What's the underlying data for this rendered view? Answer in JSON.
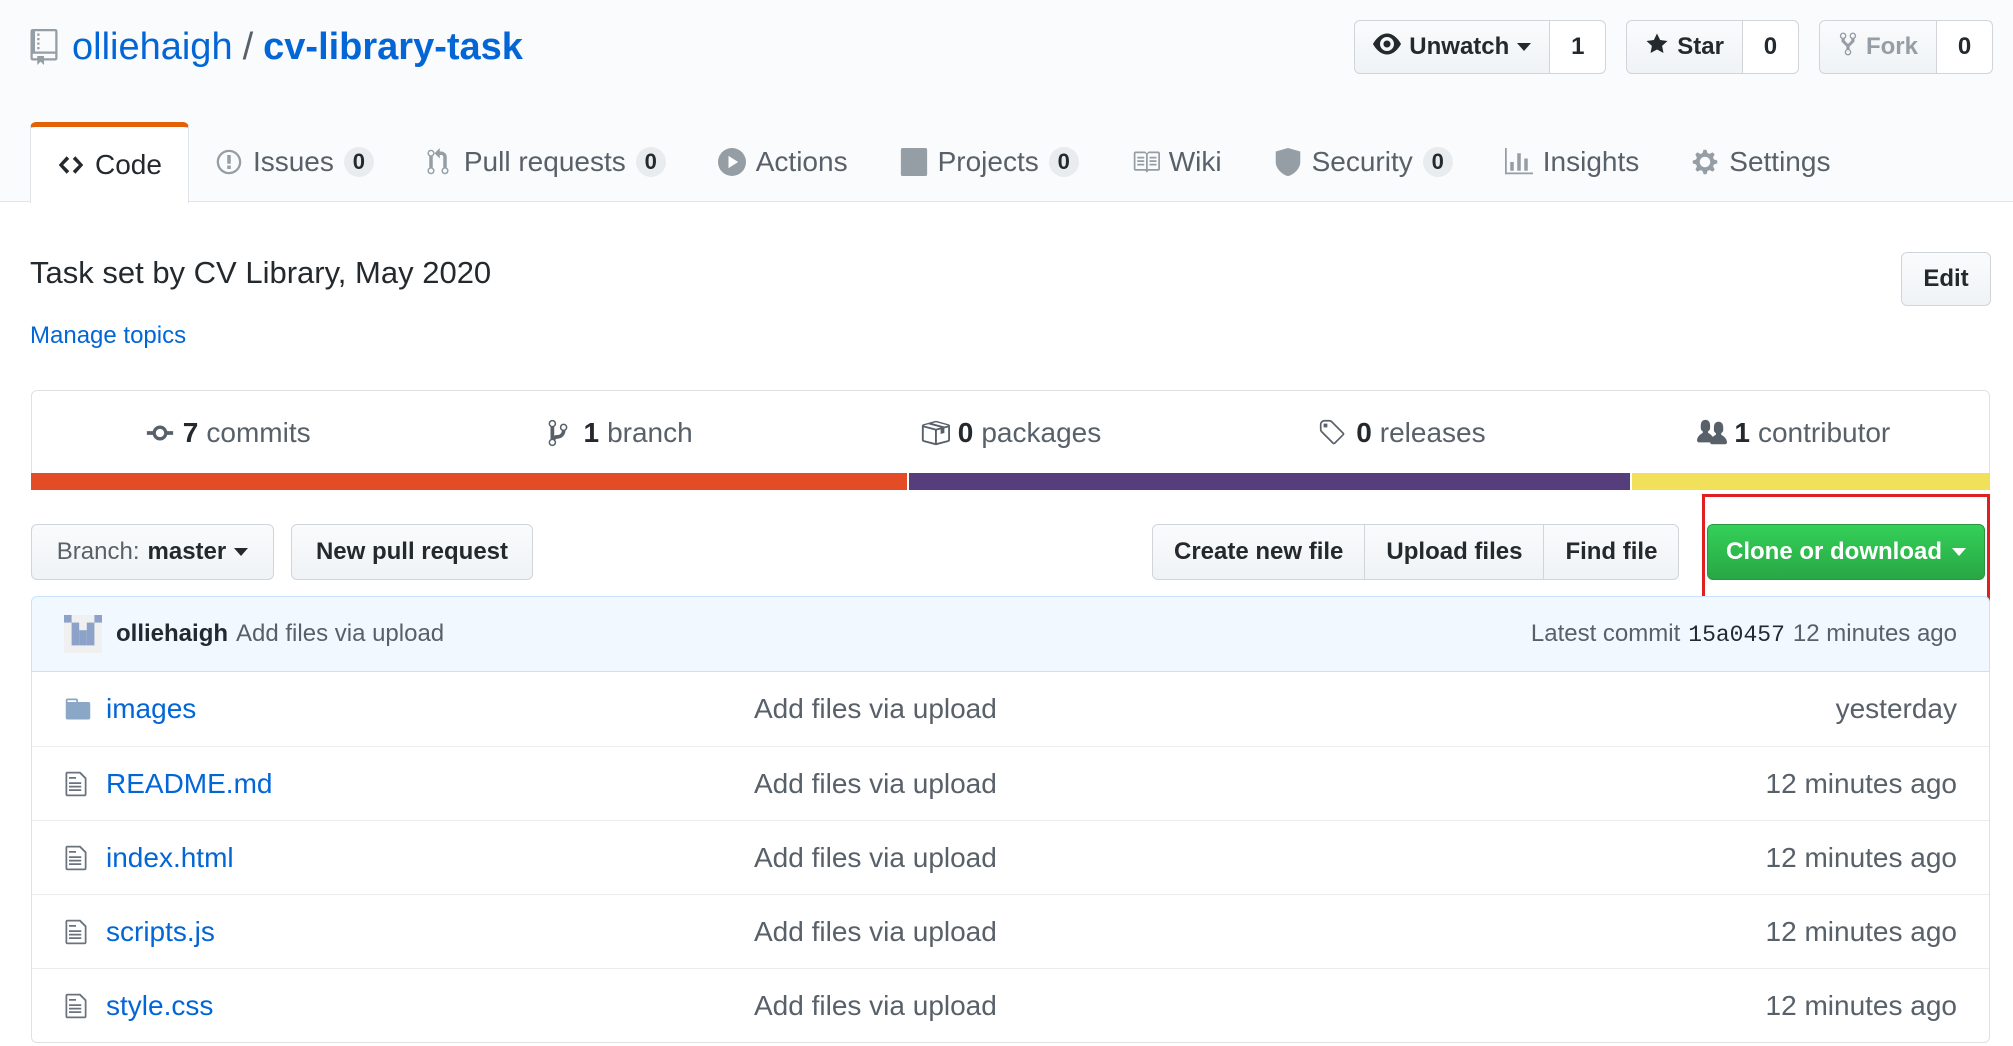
{
  "repo": {
    "owner": "olliehaigh",
    "separator": "/",
    "name": "cv-library-task"
  },
  "actions": {
    "watch_label": "Unwatch",
    "watch_count": "1",
    "star_label": "Star",
    "star_count": "0",
    "fork_label": "Fork",
    "fork_count": "0"
  },
  "tabs": [
    {
      "label": "Code",
      "icon": "code-icon"
    },
    {
      "label": "Issues",
      "count": "0",
      "icon": "issue-icon"
    },
    {
      "label": "Pull requests",
      "count": "0",
      "icon": "pull-request-icon"
    },
    {
      "label": "Actions",
      "icon": "play-icon"
    },
    {
      "label": "Projects",
      "count": "0",
      "icon": "project-icon"
    },
    {
      "label": "Wiki",
      "icon": "book-icon"
    },
    {
      "label": "Security",
      "count": "0",
      "icon": "shield-icon"
    },
    {
      "label": "Insights",
      "icon": "graph-icon"
    },
    {
      "label": "Settings",
      "icon": "gear-icon"
    }
  ],
  "about": {
    "description": "Task set by CV Library, May 2020",
    "manage_topics": "Manage topics",
    "edit_label": "Edit"
  },
  "summary": {
    "commits_num": "7",
    "commits_label": "commits",
    "branch_num": "1",
    "branch_label": "branch",
    "packages_num": "0",
    "packages_label": "packages",
    "releases_num": "0",
    "releases_label": "releases",
    "contributors_num": "1",
    "contributors_label": "contributor"
  },
  "languages": [
    {
      "color": "#e34c26",
      "share": 44.7
    },
    {
      "color": "#563d7c",
      "share": 36.9
    },
    {
      "color": "#f1e05a",
      "share": 18.4
    }
  ],
  "file_nav": {
    "branch_prefix": "Branch:",
    "branch_name": "master",
    "new_pr": "New pull request",
    "create_file": "Create new file",
    "upload_files": "Upload files",
    "find_file": "Find file",
    "clone": "Clone or download"
  },
  "latest_commit": {
    "author": "olliehaigh",
    "message": "Add files via upload",
    "prefix": "Latest commit",
    "sha": "15a0457",
    "age": "12 minutes ago"
  },
  "files": [
    {
      "name": "images",
      "type": "folder",
      "message": "Add files via upload",
      "age": "yesterday"
    },
    {
      "name": "README.md",
      "type": "file",
      "message": "Add files via upload",
      "age": "12 minutes ago"
    },
    {
      "name": "index.html",
      "type": "file",
      "message": "Add files via upload",
      "age": "12 minutes ago"
    },
    {
      "name": "scripts.js",
      "type": "file",
      "message": "Add files via upload",
      "age": "12 minutes ago"
    },
    {
      "name": "style.css",
      "type": "file",
      "message": "Add files via upload",
      "age": "12 minutes ago"
    }
  ]
}
